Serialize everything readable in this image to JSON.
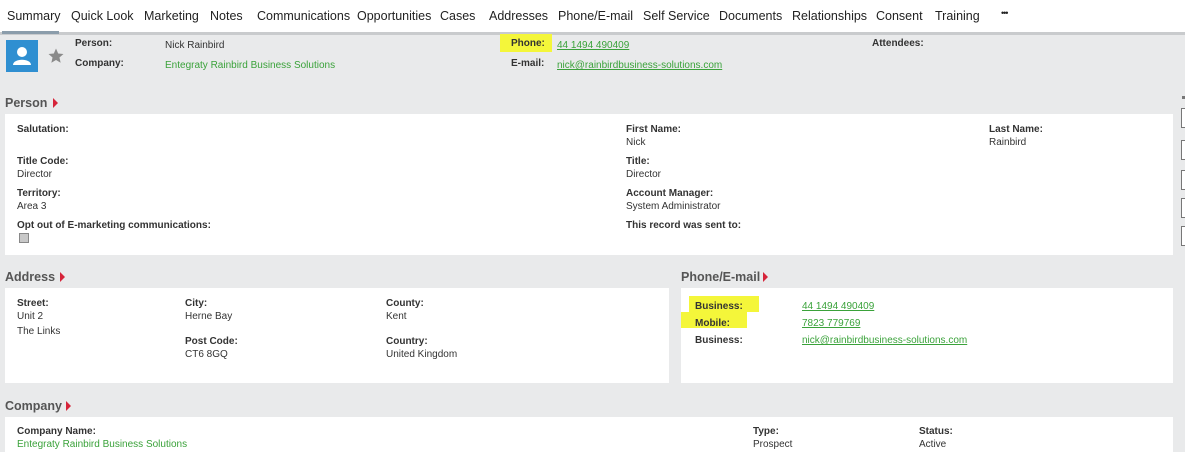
{
  "tabs": [
    "Summary",
    "Quick Look",
    "Marketing",
    "Notes",
    "Communications",
    "Opportunities",
    "Cases",
    "Addresses",
    "Phone/E-mail",
    "Self Service",
    "Documents",
    "Relationships",
    "Consent",
    "Training",
    "•••"
  ],
  "header": {
    "person_label": "Person:",
    "person_value": "Nick Rainbird",
    "company_label": "Company:",
    "company_value": "Entegraty Rainbird Business Solutions",
    "phone_label": "Phone:",
    "phone_value": "44 1494 490409",
    "email_label": "E-mail:",
    "email_value": "nick@rainbirdbusiness-solutions.com",
    "attendees_label": "Attendees:"
  },
  "person": {
    "title": "Person",
    "salutation_label": "Salutation:",
    "first_name_label": "First Name:",
    "first_name": "Nick",
    "last_name_label": "Last Name:",
    "last_name": "Rainbird",
    "title_code_label": "Title Code:",
    "title_code": "Director",
    "title_label": "Title:",
    "title_value": "Director",
    "territory_label": "Territory:",
    "territory": "Area 3",
    "account_manager_label": "Account Manager:",
    "account_manager": "System Administrator",
    "opt_out_label": "Opt out of E-marketing communications:",
    "sent_to_label": "This record was sent to:"
  },
  "address": {
    "title": "Address",
    "street_label": "Street:",
    "street_line1": "Unit 2",
    "street_line2": "The Links",
    "city_label": "City:",
    "city": "Herne Bay",
    "county_label": "County:",
    "county": "Kent",
    "post_code_label": "Post Code:",
    "post_code": "CT6 8GQ",
    "country_label": "Country:",
    "country": "United Kingdom"
  },
  "phone_email": {
    "title": "Phone/E-mail",
    "business_label": "Business:",
    "business_phone": "44 1494 490409",
    "mobile_label": "Mobile:",
    "mobile": "7823 779769",
    "business_email_label": "Business:",
    "business_email": "nick@rainbirdbusiness-solutions.com"
  },
  "company": {
    "title": "Company",
    "name_label": "Company Name:",
    "name": "Entegraty Rainbird Business Solutions",
    "type_label": "Type:",
    "type": "Prospect",
    "status_label": "Status:",
    "status": "Active"
  },
  "colors": {
    "link": "#3aa23a",
    "highlight": "#f4f63a",
    "section_arrow": "#d6243a",
    "avatar_bg": "#2f8fd1"
  }
}
